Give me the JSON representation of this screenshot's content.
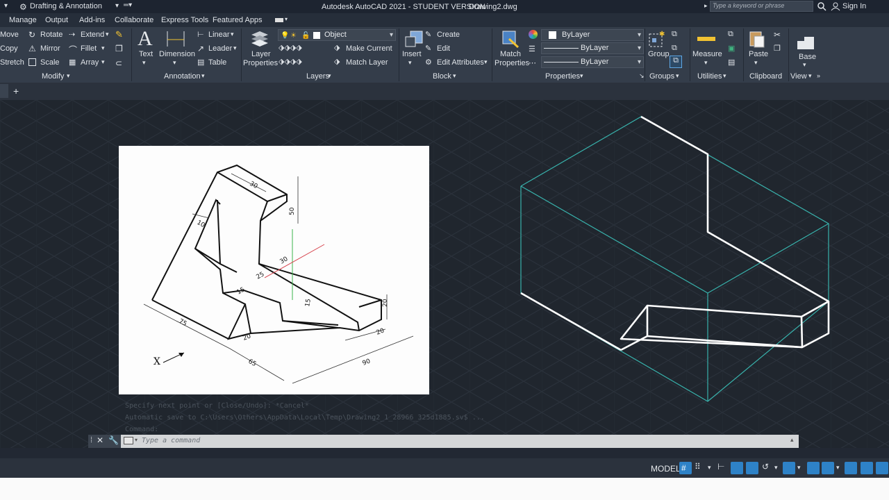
{
  "title_bar": {
    "workspace": "Drafting & Annotation",
    "app_title": "Autodesk AutoCAD 2021 - STUDENT VERSION",
    "file_name": "Drawing2.dwg",
    "search_placeholder": "Type a keyword or phrase",
    "sign_in": "Sign In"
  },
  "ribbon_tabs": [
    "Manage",
    "Output",
    "Add-ins",
    "Collaborate",
    "Express Tools",
    "Featured Apps"
  ],
  "modify": {
    "move": "Move",
    "rotate": "Rotate",
    "extend": "Extend",
    "copy": "Copy",
    "mirror": "Mirror",
    "fillet": "Fillet",
    "stretch": "Stretch",
    "scale": "Scale",
    "array": "Array",
    "label": "Modify"
  },
  "annotation": {
    "text": "Text",
    "dimension": "Dimension",
    "linear": "Linear",
    "leader": "Leader",
    "table": "Table",
    "label": "Annotation"
  },
  "layers": {
    "layer_properties_1": "Layer",
    "layer_properties_2": "Properties",
    "current_layer": "Object",
    "make_current": "Make Current",
    "match_layer": "Match Layer",
    "label": "Layers"
  },
  "block": {
    "insert": "Insert",
    "create": "Create",
    "edit": "Edit",
    "edit_attributes": "Edit Attributes",
    "label": "Block"
  },
  "properties": {
    "match_1": "Match",
    "match_2": "Properties",
    "color": "ByLayer",
    "linetype": "ByLayer",
    "lineweight": "ByLayer",
    "label": "Properties"
  },
  "groups": {
    "group": "Group",
    "label": "Groups"
  },
  "utilities": {
    "measure": "Measure",
    "label": "Utilities"
  },
  "clipboard": {
    "paste": "Paste",
    "label": "Clipboard"
  },
  "view": {
    "base": "Base",
    "label": "View"
  },
  "file_tabs": {
    "add": "+"
  },
  "reference_drawing": {
    "dims": [
      "30",
      "50",
      "10",
      "30",
      "25",
      "15",
      "15",
      "20",
      "75",
      "20",
      "65",
      "90",
      "20"
    ],
    "axis_label": "X"
  },
  "command_history": [
    "Specify next point or [Close/Undo]: *Cancel*",
    "Automatic save to C:\\Users\\Others\\AppData\\Local\\Temp\\Drawing2_1_28966_325d1885.sv$ ...",
    "Command:"
  ],
  "command_line": {
    "placeholder": "Type a command"
  },
  "status": {
    "model": "MODEL"
  },
  "colors": {
    "accent": "#38b2ac",
    "bg": "#20262e",
    "ribbon": "#343d4a",
    "status_icon": "#2e82c7"
  }
}
